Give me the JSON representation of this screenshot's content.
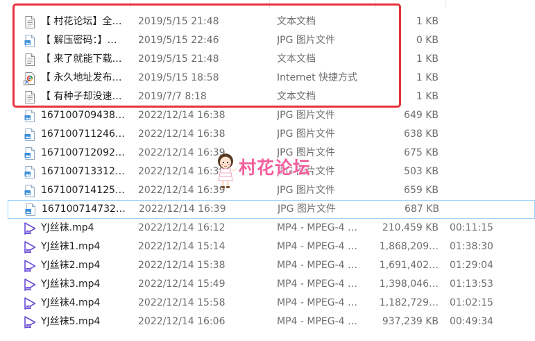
{
  "files": [
    {
      "name": "【 村花论坛】全…",
      "date": "2019/5/15 21:48",
      "type": "文本文档",
      "size": "1 KB",
      "duration": "",
      "icon": "text-file-icon"
    },
    {
      "name": "【 解压密码：】…",
      "date": "2019/5/15 22:46",
      "type": "JPG 图片文件",
      "size": "0 KB",
      "duration": "",
      "icon": "jpg-file-icon"
    },
    {
      "name": "【 来了就能下载…",
      "date": "2019/5/15 21:48",
      "type": "文本文档",
      "size": "1 KB",
      "duration": "",
      "icon": "text-file-icon"
    },
    {
      "name": "【 永久地址发布…",
      "date": "2019/5/15 18:58",
      "type": "Internet 快捷方式",
      "size": "1 KB",
      "duration": "",
      "icon": "internet-shortcut-icon"
    },
    {
      "name": "【 有种子却没速…",
      "date": "2019/7/7 8:18",
      "type": "文本文档",
      "size": "1 KB",
      "duration": "",
      "icon": "text-file-icon"
    },
    {
      "name": "167100709438…",
      "date": "2022/12/14 16:38",
      "type": "JPG 图片文件",
      "size": "649 KB",
      "duration": "",
      "icon": "jpg-file-icon"
    },
    {
      "name": "167100711246…",
      "date": "2022/12/14 16:38",
      "type": "JPG 图片文件",
      "size": "638 KB",
      "duration": "",
      "icon": "jpg-file-icon"
    },
    {
      "name": "167100712092…",
      "date": "2022/12/14 16:39",
      "type": "JPG 图片文件",
      "size": "675 KB",
      "duration": "",
      "icon": "jpg-file-icon"
    },
    {
      "name": "167100713312…",
      "date": "2022/12/14 16:39",
      "type": "JPG 图片文件",
      "size": "503 KB",
      "duration": "",
      "icon": "jpg-file-icon"
    },
    {
      "name": "167100714125…",
      "date": "2022/12/14 16:39",
      "type": "JPG 图片文件",
      "size": "659 KB",
      "duration": "",
      "icon": "jpg-file-icon"
    },
    {
      "name": "167100714732…",
      "date": "2022/12/14 16:39",
      "type": "JPG 图片文件",
      "size": "687 KB",
      "duration": "",
      "icon": "jpg-file-icon",
      "selected": true
    },
    {
      "name": "YJ丝袜.mp4",
      "date": "2022/12/14 16:12",
      "type": "MP4 - MPEG-4 …",
      "size": "210,459 KB",
      "duration": "00:11:15",
      "icon": "video-file-icon"
    },
    {
      "name": "YJ丝袜1.mp4",
      "date": "2022/12/14 15:14",
      "type": "MP4 - MPEG-4 …",
      "size": "1,868,209…",
      "duration": "01:38:30",
      "icon": "video-file-icon"
    },
    {
      "name": "YJ丝袜2.mp4",
      "date": "2022/12/14 15:38",
      "type": "MP4 - MPEG-4 …",
      "size": "1,691,402…",
      "duration": "01:29:04",
      "icon": "video-file-icon"
    },
    {
      "name": "YJ丝袜3.mp4",
      "date": "2022/12/14 15:49",
      "type": "MP4 - MPEG-4 …",
      "size": "1,398,046…",
      "duration": "01:13:53",
      "icon": "video-file-icon"
    },
    {
      "name": "YJ丝袜4.mp4",
      "date": "2022/12/14 15:58",
      "type": "MP4 - MPEG-4 …",
      "size": "1,182,729…",
      "duration": "01:02:15",
      "icon": "video-file-icon"
    },
    {
      "name": "YJ丝袜5.mp4",
      "date": "2022/12/14 16:06",
      "type": "MP4 - MPEG-4 …",
      "size": "937,239 KB",
      "duration": "00:49:34",
      "icon": "video-file-icon"
    }
  ],
  "watermark": {
    "text": "村花论坛"
  },
  "colors": {
    "highlight_border": "#e8313a",
    "selection_border": "#99d1ff",
    "video_icon": "#6b4fd8",
    "jpg_icon": "#3b8fd9",
    "watermark_text": "#f25d9c"
  }
}
